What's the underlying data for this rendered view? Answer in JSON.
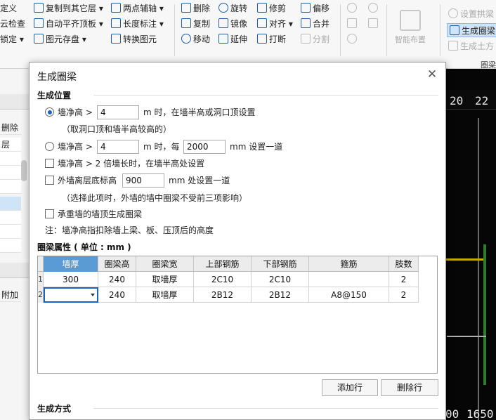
{
  "ribbon": {
    "col1": [
      "定义",
      "云检查",
      "锁定"
    ],
    "col2": [
      "复制到其它层",
      "自动平齐顶板",
      "图元存盘"
    ],
    "col3": [
      "两点辅轴",
      "长度标注",
      "转换图元"
    ],
    "col4": [
      "删除",
      "复制",
      "移动"
    ],
    "col5": [
      "旋转",
      "镜像",
      "延伸"
    ],
    "col6": [
      "修剪",
      "对齐",
      "打断"
    ],
    "col7": [
      "偏移",
      "合并",
      "分割"
    ],
    "smart_layout": "智能布置",
    "col9": [
      "设置拱梁",
      "生成圈梁",
      "生成土方"
    ],
    "group_label": "圈梁"
  },
  "left_panel": {
    "delete_label": "删除",
    "layer_label": "层",
    "add_label": "附加"
  },
  "canvas": {
    "top_numbers": [
      "20",
      "22"
    ],
    "bottom_numbers": [
      "00",
      "1650"
    ]
  },
  "dialog": {
    "title": "生成圈梁",
    "close_icon": "close-icon",
    "position_section": "生成位置",
    "opt1": {
      "label": "墙净高 >",
      "value": "4",
      "suffix": "m 时，在墙半高或洞口顶设置",
      "note": "（取洞口顶和墙半高较高的）",
      "selected": true
    },
    "opt2": {
      "label": "墙净高 >",
      "value": "4",
      "mid": "m 时，每",
      "interval": "2000",
      "suffix": "mm 设置一道",
      "selected": false
    },
    "chk1": {
      "label": "墙净高 > 2 倍墙长时，在墙半高处设置",
      "checked": false
    },
    "chk2": {
      "label": "外墙离层底标高",
      "value": "900",
      "suffix": "mm 处设置一道",
      "note": "（选择此项时，外墙的墙中圈梁不受前三项影响）",
      "checked": false
    },
    "chk3": {
      "label": "承重墙的墙顶生成圈梁",
      "checked": false
    },
    "note": "注：墙净高指扣除墙上梁、板、压顶后的高度",
    "props_section": "圈梁属性 ( 单位 : mm )",
    "columns": [
      "墙厚",
      "圈梁高",
      "圈梁宽",
      "上部钢筋",
      "下部钢筋",
      "箍筋",
      "肢数"
    ],
    "rows": [
      {
        "num": "1",
        "cells": [
          "300",
          "240",
          "取墙厚",
          "2C10",
          "2C10",
          "",
          "2"
        ]
      },
      {
        "num": "2",
        "cells": [
          "",
          "240",
          "取墙厚",
          "2B12",
          "2B12",
          "A8@150",
          "2"
        ]
      }
    ],
    "add_row": "添加行",
    "delete_row": "删除行",
    "method_section": "生成方式"
  }
}
